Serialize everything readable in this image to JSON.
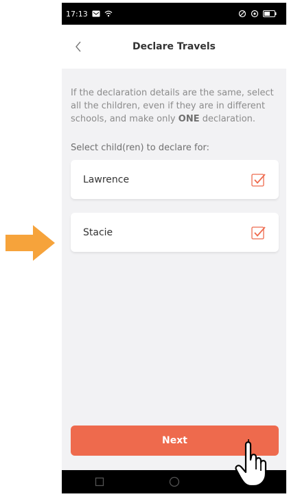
{
  "status_bar": {
    "time": "17:13"
  },
  "header": {
    "title": "Declare Travels",
    "back_icon": "chevron-left-icon"
  },
  "intro": {
    "text_before": "If the declaration details are the same, select all the children, even if they are in different schools, and make only ",
    "emphasis": "ONE",
    "text_after": " declaration."
  },
  "select_label": "Select child(ren) to declare for:",
  "children": [
    {
      "name": "Lawrence",
      "checked": true
    },
    {
      "name": "Stacie",
      "checked": true
    }
  ],
  "next_button": {
    "label": "Next"
  },
  "colors": {
    "accent": "#ee6a4d",
    "annotation_arrow": "#f6a33b",
    "background": "#f2f2f4"
  },
  "icons": {
    "annotation": "arrow-right-icon",
    "cursor": "hand-pointer-icon",
    "nav": [
      "square-icon",
      "circle-icon",
      "triangle-back-icon"
    ]
  }
}
